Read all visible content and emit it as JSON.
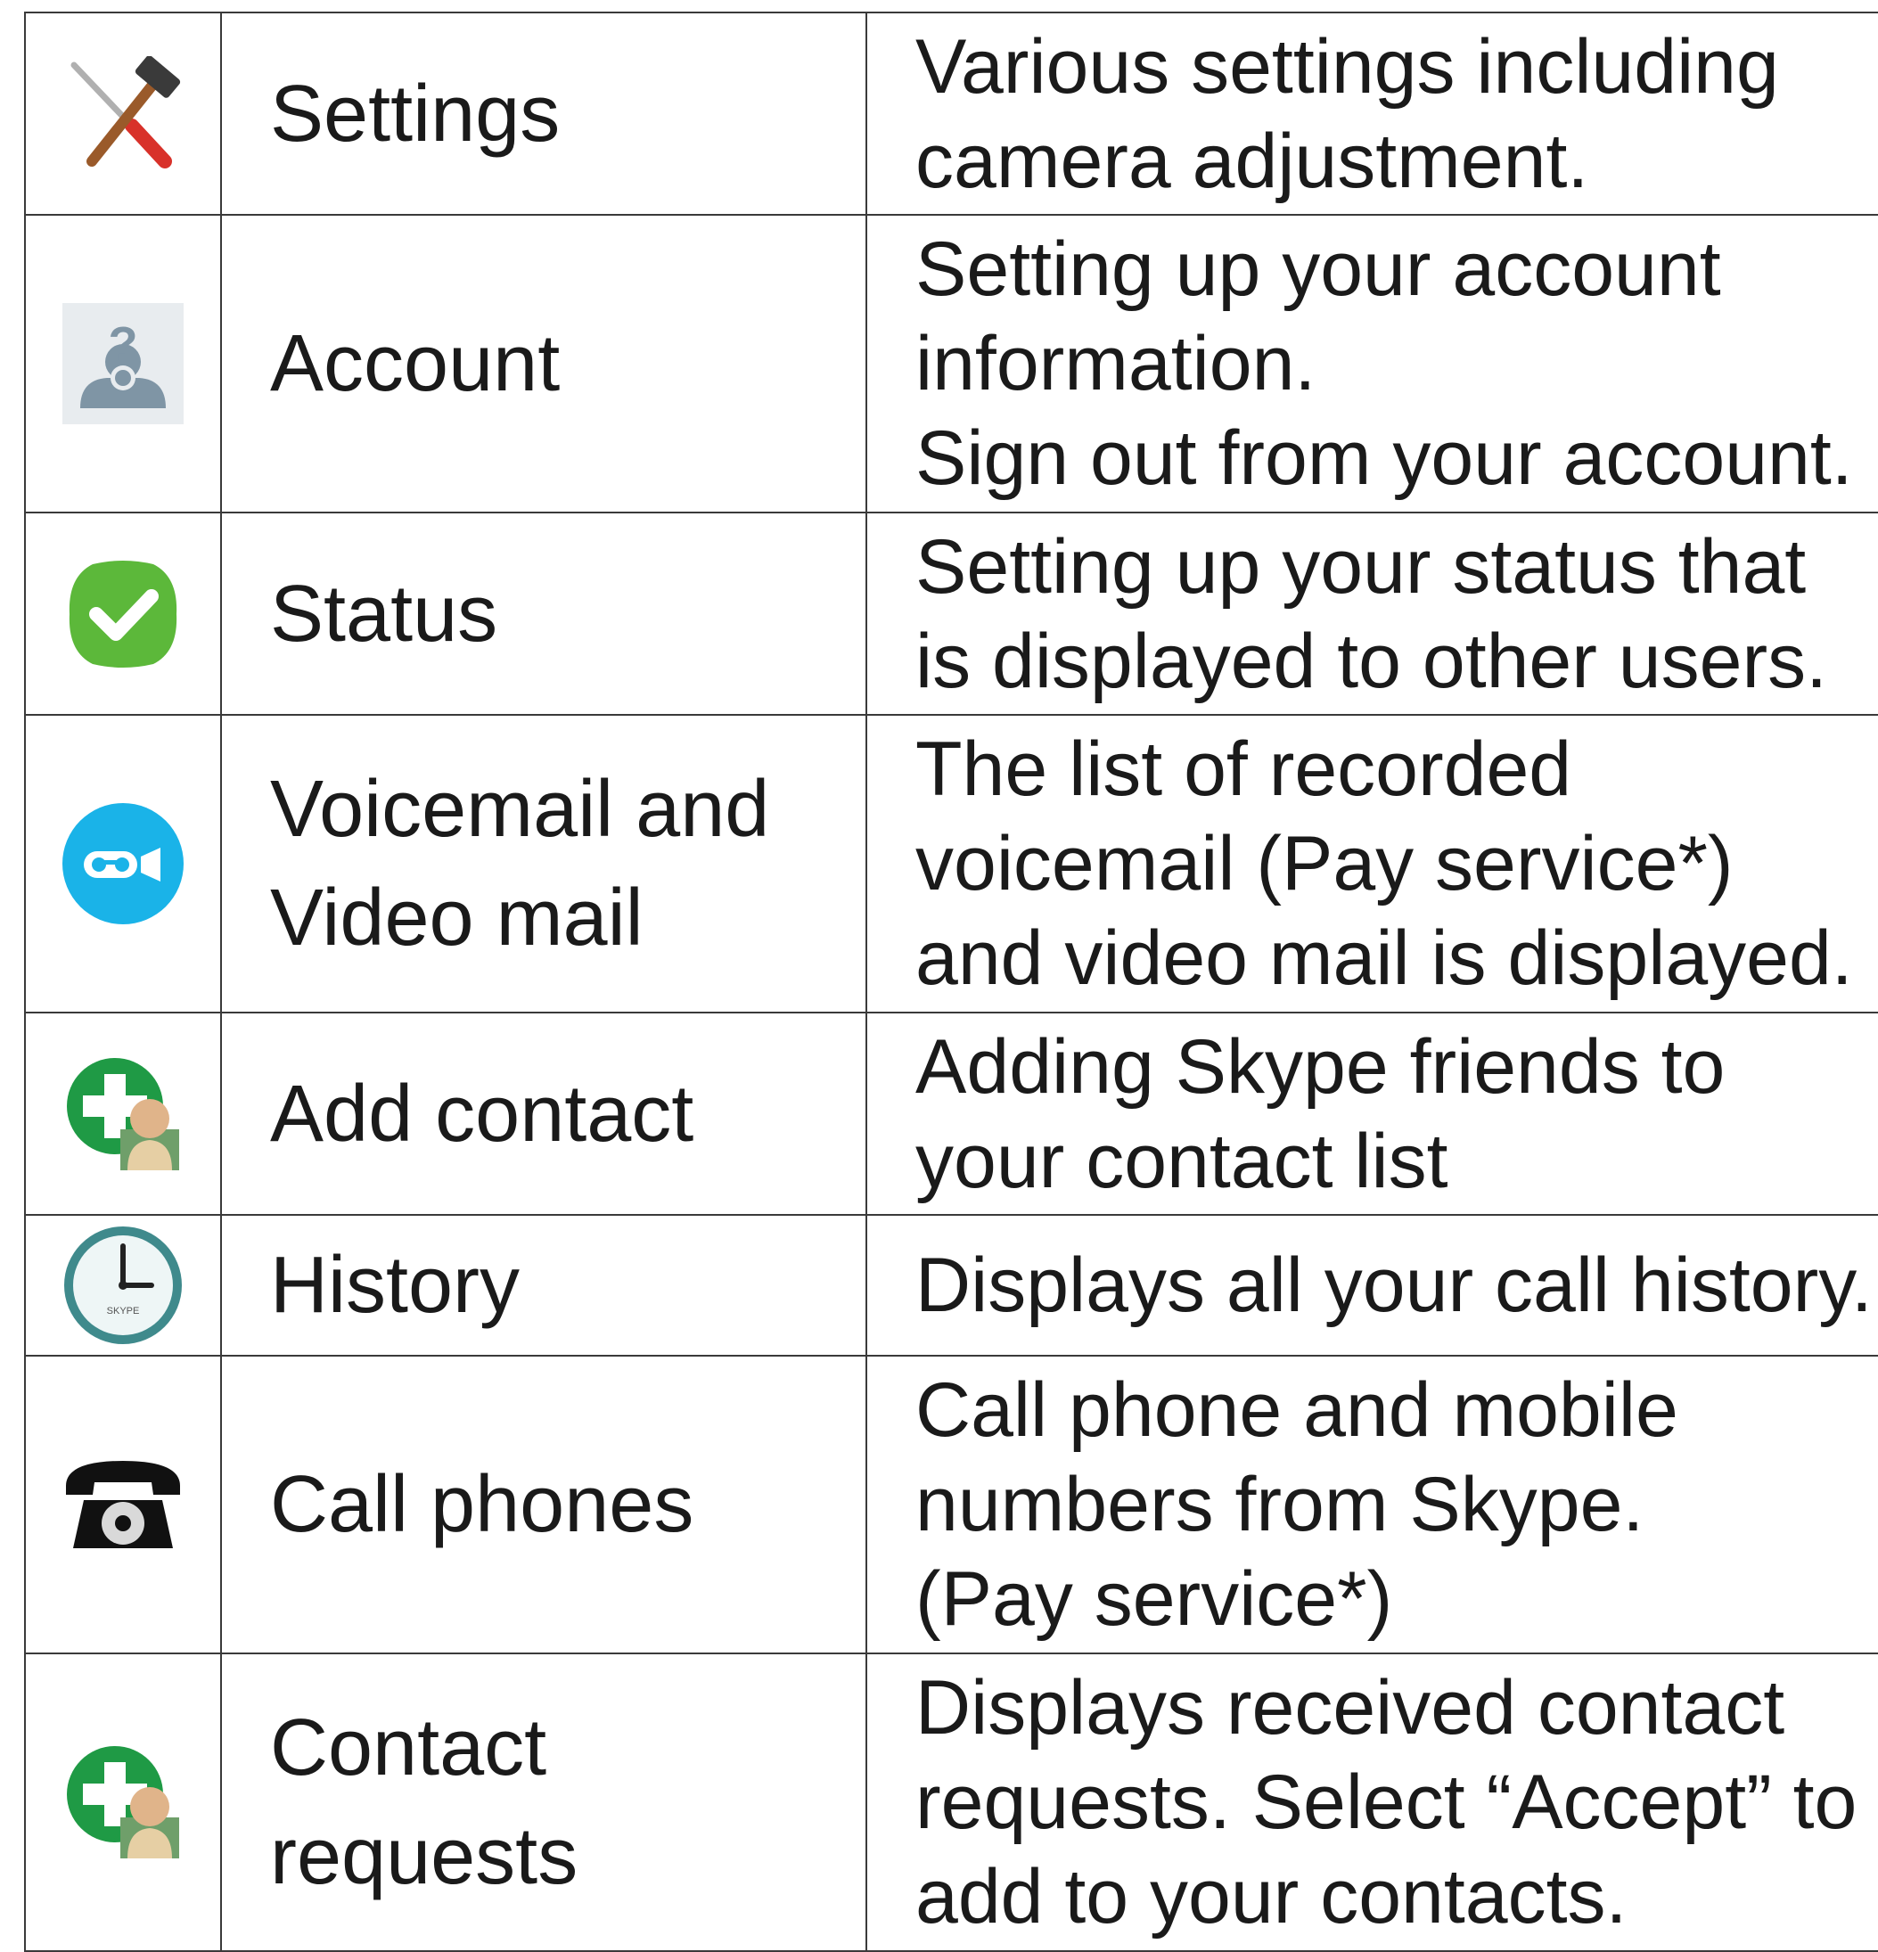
{
  "rows": [
    {
      "icon": "settings-tools-icon",
      "name": "Settings",
      "desc": [
        "Various settings including",
        "camera adjustment."
      ]
    },
    {
      "icon": "account-user-icon",
      "name": "Account",
      "desc": [
        "Setting up your account",
        "information.",
        "Sign out from your account."
      ]
    },
    {
      "icon": "status-check-icon",
      "name": "Status",
      "desc": [
        "Setting up your status that",
        "is displayed to other users."
      ]
    },
    {
      "icon": "voicemail-video-icon",
      "name_lines": [
        "Voicemail and",
        "Video mail"
      ],
      "desc": [
        "The list of recorded",
        "voicemail (Pay service*)",
        "and video mail is displayed."
      ]
    },
    {
      "icon": "add-contact-icon",
      "name": "Add contact",
      "desc": [
        "Adding Skype friends to",
        "your contact list"
      ]
    },
    {
      "icon": "history-clock-icon",
      "icon_text": "SKYPE",
      "name": "History",
      "desc": [
        "Displays all your call history."
      ]
    },
    {
      "icon": "telephone-icon",
      "name": "Call phones",
      "desc": [
        "Call phone and mobile",
        "numbers from Skype.",
        "(Pay service*)"
      ]
    },
    {
      "icon": "contact-requests-icon",
      "name_lines": [
        "Contact",
        "requests"
      ],
      "desc": [
        "Displays received contact",
        "requests. Select “Accept” to",
        "add to your contacts."
      ]
    }
  ]
}
